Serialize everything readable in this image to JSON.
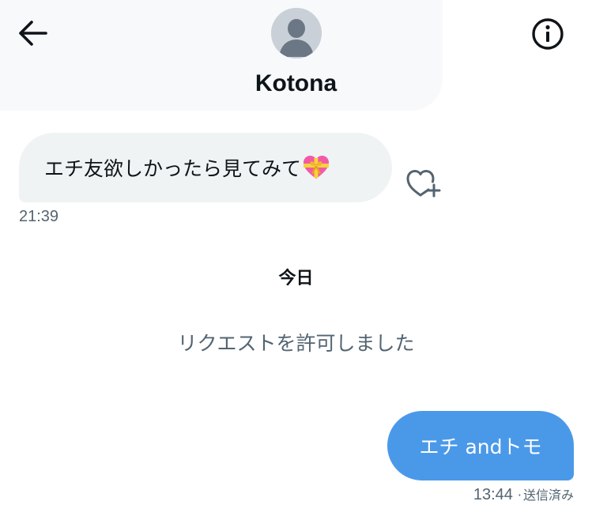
{
  "header": {
    "contact_name": "Kotona",
    "back_icon": "arrow-left-icon",
    "info_icon": "info-circle-icon",
    "avatar_icon": "default-avatar-icon"
  },
  "messages": {
    "incoming": {
      "text": "エチ友欲しかったら見てみて",
      "emoji_icon": "heart-with-ribbon-icon",
      "time": "21:39",
      "like_icon": "heart-plus-icon"
    },
    "day_separator": "今日",
    "system_notice": "リクエストを許可しました",
    "outgoing": {
      "text": "エチ andトモ",
      "time": "13:44",
      "separator": "·",
      "status": "送信済み"
    }
  },
  "colors": {
    "outgoing_bubble": "#4a99e9",
    "incoming_bubble": "#eff3f4",
    "secondary_text": "#536471",
    "primary_text": "#0f1419"
  }
}
